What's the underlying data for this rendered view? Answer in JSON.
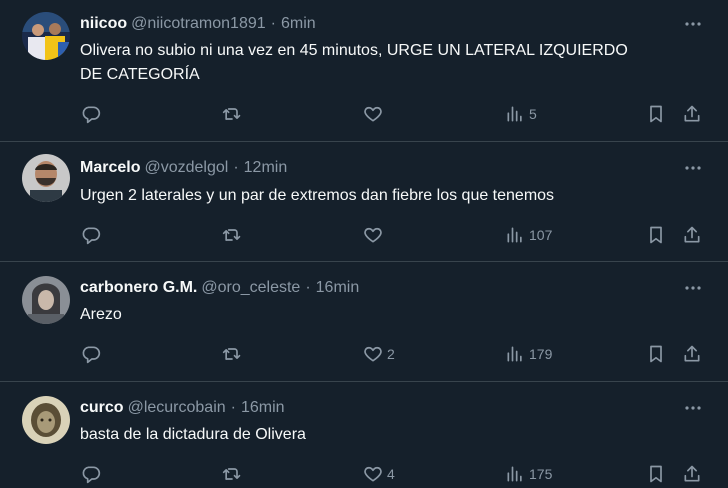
{
  "tweets": [
    {
      "name": "niicoo",
      "handle": "@niicotramon1891",
      "time": "6min",
      "text_lines": [
        "Olivera no subio ni una vez en 45 minutos, URGE UN LATERAL IZQUIERDO",
        "DE CATEGORÍA"
      ],
      "reply_count": "",
      "retweet_count": "",
      "like_count": "",
      "view_count": "5"
    },
    {
      "name": "Marcelo",
      "handle": "@vozdelgol",
      "time": "12min",
      "text_lines": [
        "Urgen 2 laterales y un par de extremos dan fiebre los que tenemos"
      ],
      "reply_count": "",
      "retweet_count": "",
      "like_count": "",
      "view_count": "107"
    },
    {
      "name": "carbonero G.M.",
      "handle": "@oro_celeste",
      "time": "16min",
      "text_lines": [
        "Arezo"
      ],
      "reply_count": "",
      "retweet_count": "",
      "like_count": "2",
      "view_count": "179"
    },
    {
      "name": "curco",
      "handle": "@lecurcobain",
      "time": "16min",
      "text_lines": [
        "basta de la dictadura de Olivera"
      ],
      "reply_count": "",
      "retweet_count": "",
      "like_count": "4",
      "view_count": "175"
    }
  ],
  "separator": "·",
  "colors": {
    "background": "#15202b",
    "text": "#f7f9f9",
    "secondary": "#8b98a5",
    "border": "#38444d"
  },
  "icons": [
    "more-icon",
    "reply-icon",
    "retweet-icon",
    "like-icon",
    "views-icon",
    "bookmark-icon",
    "share-icon"
  ]
}
